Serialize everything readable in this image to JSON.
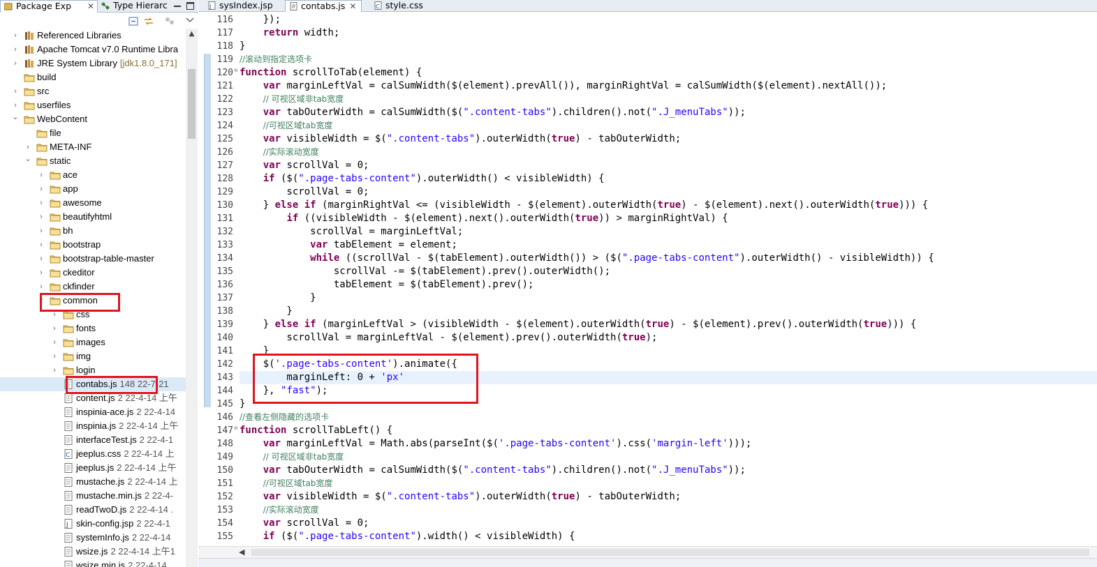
{
  "left_panel": {
    "tabs": [
      {
        "label": "Package Exp",
        "icon": "package-explorer-icon",
        "active": true
      },
      {
        "label": "Type Hierarc",
        "icon": "type-hierarchy-icon",
        "active": false
      }
    ],
    "close_glyph": "✕",
    "window_controls": [
      "minimize",
      "maximize"
    ],
    "toolbar_icons": [
      "collapse-all-icon",
      "link-with-editor-icon",
      "view-menu-icon"
    ],
    "tree": [
      {
        "label": "Referenced Libraries",
        "deco": "",
        "icon": "library-icon",
        "depth": 0,
        "arrow": "›"
      },
      {
        "label": "Apache Tomcat v7.0 Runtime Libra",
        "deco": "",
        "icon": "library-icon",
        "depth": 0,
        "arrow": "›"
      },
      {
        "label": "JRE System Library",
        "deco": "[jdk1.8.0_171]",
        "icon": "library-icon",
        "depth": 0,
        "arrow": "›"
      },
      {
        "label": "build",
        "deco": "",
        "icon": "folder-icon",
        "depth": 0,
        "arrow": ""
      },
      {
        "label": "src",
        "deco": "",
        "icon": "folder-icon",
        "depth": 0,
        "arrow": "›"
      },
      {
        "label": "userfiles",
        "deco": "",
        "icon": "folder-icon",
        "depth": 0,
        "arrow": "›"
      },
      {
        "label": "WebContent",
        "deco": "",
        "icon": "folder-icon",
        "depth": 0,
        "arrow": "⌄"
      },
      {
        "label": "file",
        "deco": "",
        "icon": "folder-icon",
        "depth": 1,
        "arrow": ""
      },
      {
        "label": "META-INF",
        "deco": "",
        "icon": "folder-icon",
        "depth": 1,
        "arrow": "›"
      },
      {
        "label": "static",
        "deco": "",
        "icon": "folder-icon",
        "depth": 1,
        "arrow": "⌄"
      },
      {
        "label": "ace",
        "deco": "",
        "icon": "folder-icon",
        "depth": 2,
        "arrow": "›"
      },
      {
        "label": "app",
        "deco": "",
        "icon": "folder-icon",
        "depth": 2,
        "arrow": "›"
      },
      {
        "label": "awesome",
        "deco": "",
        "icon": "folder-icon",
        "depth": 2,
        "arrow": "›"
      },
      {
        "label": "beautifyhtml",
        "deco": "",
        "icon": "folder-icon",
        "depth": 2,
        "arrow": "›"
      },
      {
        "label": "bh",
        "deco": "",
        "icon": "folder-icon",
        "depth": 2,
        "arrow": "›"
      },
      {
        "label": "bootstrap",
        "deco": "",
        "icon": "folder-icon",
        "depth": 2,
        "arrow": "›"
      },
      {
        "label": "bootstrap-table-master",
        "deco": "",
        "icon": "folder-icon",
        "depth": 2,
        "arrow": "›"
      },
      {
        "label": "ckeditor",
        "deco": "",
        "icon": "folder-icon",
        "depth": 2,
        "arrow": "›"
      },
      {
        "label": "ckfinder",
        "deco": "",
        "icon": "folder-icon",
        "depth": 2,
        "arrow": "›"
      },
      {
        "label": "common",
        "deco": "",
        "icon": "folder-icon",
        "depth": 2,
        "arrow": "⌄"
      },
      {
        "label": "css",
        "deco": "",
        "icon": "folder-icon",
        "depth": 3,
        "arrow": "›"
      },
      {
        "label": "fonts",
        "deco": "",
        "icon": "folder-icon",
        "depth": 3,
        "arrow": "›"
      },
      {
        "label": "images",
        "deco": "",
        "icon": "folder-icon",
        "depth": 3,
        "arrow": "›"
      },
      {
        "label": "img",
        "deco": "",
        "icon": "folder-icon",
        "depth": 3,
        "arrow": "›"
      },
      {
        "label": "login",
        "deco": "",
        "icon": "folder-icon",
        "depth": 3,
        "arrow": "›"
      },
      {
        "label": "contabs.js",
        "deco": "148  22-7-21 ",
        "icon": "js-file-icon",
        "depth": 3,
        "arrow": "",
        "selected": true
      },
      {
        "label": "content.js",
        "deco": "2   22-4-14 上午",
        "icon": "js-file-icon",
        "depth": 3,
        "arrow": ""
      },
      {
        "label": "inspinia-ace.js",
        "deco": "2  22-4-14",
        "icon": "js-file-icon",
        "depth": 3,
        "arrow": ""
      },
      {
        "label": "inspinia.js",
        "deco": "2  22-4-14 上午",
        "icon": "js-file-icon",
        "depth": 3,
        "arrow": ""
      },
      {
        "label": "interfaceTest.js",
        "deco": "2  22-4-1",
        "icon": "js-file-icon",
        "depth": 3,
        "arrow": ""
      },
      {
        "label": "jeeplus.css",
        "deco": "2  22-4-14 上",
        "icon": "css-file-icon",
        "depth": 3,
        "arrow": ""
      },
      {
        "label": "jeeplus.js",
        "deco": "2  22-4-14 上午",
        "icon": "js-file-icon",
        "depth": 3,
        "arrow": ""
      },
      {
        "label": "mustache.js",
        "deco": "2  22-4-14 上",
        "icon": "js-file-icon",
        "depth": 3,
        "arrow": ""
      },
      {
        "label": "mustache.min.js",
        "deco": "2  22-4-",
        "icon": "js-file-icon",
        "depth": 3,
        "arrow": ""
      },
      {
        "label": "readTwoD.js",
        "deco": "2  22-4-14 .",
        "icon": "js-file-icon",
        "depth": 3,
        "arrow": ""
      },
      {
        "label": "skin-config.jsp",
        "deco": "2  22-4-1",
        "icon": "jsp-file-icon",
        "depth": 3,
        "arrow": ""
      },
      {
        "label": "systemInfo.js",
        "deco": "2  22-4-14",
        "icon": "js-file-icon",
        "depth": 3,
        "arrow": ""
      },
      {
        "label": "wsize.js",
        "deco": "2  22-4-14 上午1",
        "icon": "js-file-icon",
        "depth": 3,
        "arrow": ""
      },
      {
        "label": "wsize.min.js",
        "deco": "2  22-4-14",
        "icon": "js-file-icon",
        "depth": 3,
        "arrow": ""
      }
    ]
  },
  "editor": {
    "tabs": [
      {
        "label": "sysIndex.jsp",
        "icon": "jsp-file-icon",
        "active": false
      },
      {
        "label": "contabs.js",
        "icon": "js-file-icon",
        "active": true
      },
      {
        "label": "style.css",
        "icon": "css-file-icon",
        "active": false
      }
    ],
    "close_glyph": "✕",
    "current_line": 143,
    "lines": [
      {
        "n": "116",
        "fold": "",
        "tokens": [
          [
            "p",
            "    });"
          ]
        ]
      },
      {
        "n": "117",
        "fold": "",
        "tokens": [
          [
            "p",
            "    "
          ],
          [
            "kw",
            "return"
          ],
          [
            "p",
            " width;"
          ]
        ]
      },
      {
        "n": "118",
        "fold": "",
        "tokens": [
          [
            "p",
            "}"
          ]
        ]
      },
      {
        "n": "119",
        "fold": "",
        "tokens": [
          [
            "cm",
            "//滚动到指定选项卡"
          ]
        ]
      },
      {
        "n": "120",
        "fold": "⊖",
        "tokens": [
          [
            "kw",
            "function"
          ],
          [
            "p",
            " scrollToTab(element) {"
          ]
        ]
      },
      {
        "n": "121",
        "fold": "",
        "tokens": [
          [
            "p",
            "    "
          ],
          [
            "kw",
            "var"
          ],
          [
            "p",
            " marginLeftVal = calSumWidth($(element).prevAll()), marginRightVal = calSumWidth($(element).nextAll());"
          ]
        ]
      },
      {
        "n": "122",
        "fold": "",
        "tokens": [
          [
            "p",
            "    "
          ],
          [
            "cm",
            "// 可视区域非tab宽度"
          ]
        ]
      },
      {
        "n": "123",
        "fold": "",
        "tokens": [
          [
            "p",
            "    "
          ],
          [
            "kw",
            "var"
          ],
          [
            "p",
            " tabOuterWidth = calSumWidth($("
          ],
          [
            "st",
            "\".content-tabs\""
          ],
          [
            "p",
            ").children().not("
          ],
          [
            "st",
            "\".J_menuTabs\""
          ],
          [
            "p",
            "));"
          ]
        ]
      },
      {
        "n": "124",
        "fold": "",
        "tokens": [
          [
            "p",
            "    "
          ],
          [
            "cm",
            "//可视区域tab宽度"
          ]
        ]
      },
      {
        "n": "125",
        "fold": "",
        "tokens": [
          [
            "p",
            "    "
          ],
          [
            "kw",
            "var"
          ],
          [
            "p",
            " visibleWidth = $("
          ],
          [
            "st",
            "\".content-tabs\""
          ],
          [
            "p",
            ").outerWidth("
          ],
          [
            "kw",
            "true"
          ],
          [
            "p",
            ") - tabOuterWidth;"
          ]
        ]
      },
      {
        "n": "126",
        "fold": "",
        "tokens": [
          [
            "p",
            "    "
          ],
          [
            "cm",
            "//实际滚动宽度"
          ]
        ]
      },
      {
        "n": "127",
        "fold": "",
        "tokens": [
          [
            "p",
            "    "
          ],
          [
            "kw",
            "var"
          ],
          [
            "p",
            " scrollVal = 0;"
          ]
        ]
      },
      {
        "n": "128",
        "fold": "",
        "tokens": [
          [
            "p",
            "    "
          ],
          [
            "kw",
            "if"
          ],
          [
            "p",
            " ($("
          ],
          [
            "st",
            "\".page-tabs-content\""
          ],
          [
            "p",
            ").outerWidth() < visibleWidth) {"
          ]
        ]
      },
      {
        "n": "129",
        "fold": "",
        "tokens": [
          [
            "p",
            "        scrollVal = 0;"
          ]
        ]
      },
      {
        "n": "130",
        "fold": "",
        "tokens": [
          [
            "p",
            "    } "
          ],
          [
            "kw",
            "else if"
          ],
          [
            "p",
            " (marginRightVal <= (visibleWidth - $(element).outerWidth("
          ],
          [
            "kw",
            "true"
          ],
          [
            "p",
            ") - $(element).next().outerWidth("
          ],
          [
            "kw",
            "true"
          ],
          [
            "p",
            "))) {"
          ]
        ]
      },
      {
        "n": "131",
        "fold": "",
        "tokens": [
          [
            "p",
            "        "
          ],
          [
            "kw",
            "if"
          ],
          [
            "p",
            " ((visibleWidth - $(element).next().outerWidth("
          ],
          [
            "kw",
            "true"
          ],
          [
            "p",
            ")) > marginRightVal) {"
          ]
        ]
      },
      {
        "n": "132",
        "fold": "",
        "tokens": [
          [
            "p",
            "            scrollVal = marginLeftVal;"
          ]
        ]
      },
      {
        "n": "133",
        "fold": "",
        "tokens": [
          [
            "p",
            "            "
          ],
          [
            "kw",
            "var"
          ],
          [
            "p",
            " tabElement = element;"
          ]
        ]
      },
      {
        "n": "134",
        "fold": "",
        "tokens": [
          [
            "p",
            "            "
          ],
          [
            "kw",
            "while"
          ],
          [
            "p",
            " ((scrollVal - $(tabElement).outerWidth()) > ($("
          ],
          [
            "st",
            "\".page-tabs-content\""
          ],
          [
            "p",
            ").outerWidth() - visibleWidth)) {"
          ]
        ]
      },
      {
        "n": "135",
        "fold": "",
        "tokens": [
          [
            "p",
            "                scrollVal -= $(tabElement).prev().outerWidth();"
          ]
        ]
      },
      {
        "n": "136",
        "fold": "",
        "tokens": [
          [
            "p",
            "                tabElement = $(tabElement).prev();"
          ]
        ]
      },
      {
        "n": "137",
        "fold": "",
        "tokens": [
          [
            "p",
            "            }"
          ]
        ]
      },
      {
        "n": "138",
        "fold": "",
        "tokens": [
          [
            "p",
            "        }"
          ]
        ]
      },
      {
        "n": "139",
        "fold": "",
        "tokens": [
          [
            "p",
            "    } "
          ],
          [
            "kw",
            "else if"
          ],
          [
            "p",
            " (marginLeftVal > (visibleWidth - $(element).outerWidth("
          ],
          [
            "kw",
            "true"
          ],
          [
            "p",
            ") - $(element).prev().outerWidth("
          ],
          [
            "kw",
            "true"
          ],
          [
            "p",
            "))) {"
          ]
        ]
      },
      {
        "n": "140",
        "fold": "",
        "tokens": [
          [
            "p",
            "        scrollVal = marginLeftVal - $(element).prev().outerWidth("
          ],
          [
            "kw",
            "true"
          ],
          [
            "p",
            ");"
          ]
        ]
      },
      {
        "n": "141",
        "fold": "",
        "tokens": [
          [
            "p",
            "    }"
          ]
        ]
      },
      {
        "n": "142",
        "fold": "",
        "tokens": [
          [
            "p",
            "    $("
          ],
          [
            "st",
            "'.page-tabs-content'"
          ],
          [
            "p",
            ").animate({"
          ]
        ]
      },
      {
        "n": "143",
        "fold": "",
        "tokens": [
          [
            "p",
            "        marginLeft: 0 + "
          ],
          [
            "st",
            "'px'"
          ]
        ]
      },
      {
        "n": "144",
        "fold": "",
        "tokens": [
          [
            "p",
            "    }, "
          ],
          [
            "st",
            "\"fast\""
          ],
          [
            "p",
            ");"
          ]
        ]
      },
      {
        "n": "145",
        "fold": "",
        "tokens": [
          [
            "p",
            "}"
          ]
        ]
      },
      {
        "n": "146",
        "fold": "",
        "tokens": [
          [
            "cm",
            "//查看左侧隐藏的选项卡"
          ]
        ]
      },
      {
        "n": "147",
        "fold": "⊖",
        "tokens": [
          [
            "kw",
            "function"
          ],
          [
            "p",
            " scrollTabLeft() {"
          ]
        ]
      },
      {
        "n": "148",
        "fold": "",
        "tokens": [
          [
            "p",
            "    "
          ],
          [
            "kw",
            "var"
          ],
          [
            "p",
            " marginLeftVal = Math.abs(parseInt($("
          ],
          [
            "st",
            "'.page-tabs-content'"
          ],
          [
            "p",
            ").css("
          ],
          [
            "st",
            "'margin-left'"
          ],
          [
            "p",
            ")));"
          ]
        ]
      },
      {
        "n": "149",
        "fold": "",
        "tokens": [
          [
            "p",
            "    "
          ],
          [
            "cm",
            "// 可视区域非tab宽度"
          ]
        ]
      },
      {
        "n": "150",
        "fold": "",
        "tokens": [
          [
            "p",
            "    "
          ],
          [
            "kw",
            "var"
          ],
          [
            "p",
            " tabOuterWidth = calSumWidth($("
          ],
          [
            "st",
            "\".content-tabs\""
          ],
          [
            "p",
            ").children().not("
          ],
          [
            "st",
            "\".J_menuTabs\""
          ],
          [
            "p",
            "));"
          ]
        ]
      },
      {
        "n": "151",
        "fold": "",
        "tokens": [
          [
            "p",
            "    "
          ],
          [
            "cm",
            "//可视区域tab宽度"
          ]
        ]
      },
      {
        "n": "152",
        "fold": "",
        "tokens": [
          [
            "p",
            "    "
          ],
          [
            "kw",
            "var"
          ],
          [
            "p",
            " visibleWidth = $("
          ],
          [
            "st",
            "\".content-tabs\""
          ],
          [
            "p",
            ").outerWidth("
          ],
          [
            "kw",
            "true"
          ],
          [
            "p",
            ") - tabOuterWidth;"
          ]
        ]
      },
      {
        "n": "153",
        "fold": "",
        "tokens": [
          [
            "p",
            "    "
          ],
          [
            "cm",
            "//实际滚动宽度"
          ]
        ]
      },
      {
        "n": "154",
        "fold": "",
        "tokens": [
          [
            "p",
            "    "
          ],
          [
            "kw",
            "var"
          ],
          [
            "p",
            " scrollVal = 0;"
          ]
        ]
      },
      {
        "n": "155",
        "fold": "",
        "tokens": [
          [
            "p",
            "    "
          ],
          [
            "kw",
            "if"
          ],
          [
            "p",
            " ($("
          ],
          [
            "st",
            "\".page-tabs-content\""
          ],
          [
            "p",
            ").width() < visibleWidth) {"
          ]
        ]
      }
    ]
  },
  "colors": {
    "keyword": "#7f0055",
    "string": "#2a00ff",
    "comment": "#3f7f5f",
    "highlight_box": "#e0141e",
    "current_line": "#e8f2fe"
  }
}
